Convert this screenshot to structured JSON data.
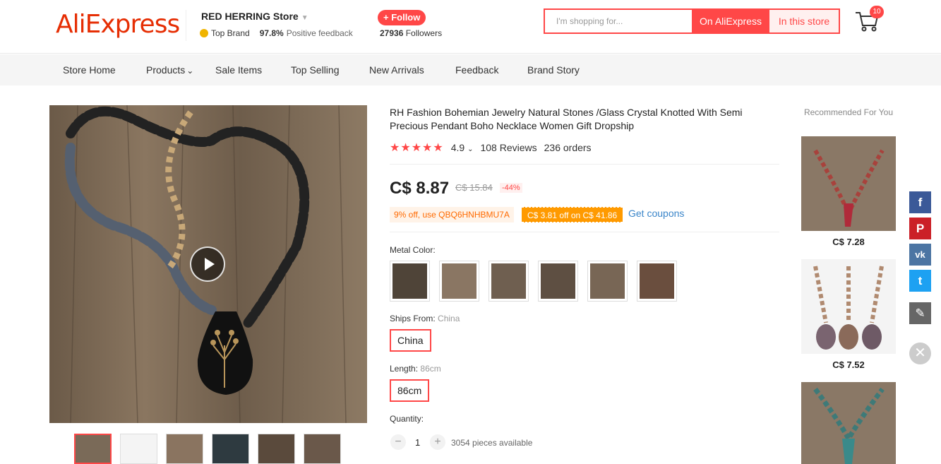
{
  "header": {
    "logo_text": "AliExpress",
    "store_name": "RED HERRING Store",
    "top_brand": "Top Brand",
    "positive_pct": "97.8%",
    "positive_label": "Positive feedback",
    "follow_label": "+ Follow",
    "followers_count": "27936",
    "followers_label": "Followers",
    "search_placeholder": "I'm shopping for...",
    "search_ali_label": "On AliExpress",
    "search_store_label": "In this store",
    "cart_count": "10"
  },
  "nav": {
    "items": [
      "Store Home",
      "Products",
      "Sale Items",
      "Top Selling",
      "New Arrivals",
      "Feedback",
      "Brand Story"
    ]
  },
  "product": {
    "title": "RH Fashion Bohemian Jewelry Natural Stones /Glass Crystal Knotted With Semi Precious Pendant Boho Necklace Women Gift Dropship",
    "rating": "4.9",
    "reviews": "108 Reviews",
    "orders": "236 orders",
    "price": "C$ 8.87",
    "price_old": "C$ 15.84",
    "discount": "-44%",
    "coupon_code_text": "9% off, use QBQ6HNHBMU7A",
    "coupon_store_text": "C$ 3.81 off on C$ 41.86",
    "get_coupons": "Get coupons",
    "metal_color_label": "Metal Color:",
    "ships_from_label": "Ships From:",
    "ships_from_value": "China",
    "ships_from_option": "China",
    "length_label": "Length:",
    "length_value": "86cm",
    "length_option": "86cm",
    "quantity_label": "Quantity:",
    "quantity_value": "1",
    "quantity_available": "3054 pieces available"
  },
  "recommended": {
    "title": "Recommended For You",
    "items": [
      {
        "price": "C$ 7.28"
      },
      {
        "price": "C$ 7.52"
      }
    ]
  },
  "share": {
    "facebook": "f",
    "pinterest": "P",
    "vk": "vk",
    "twitter": "t",
    "edit": "✎",
    "close": "✕"
  },
  "colors": {
    "brand": "#ff4747",
    "logo": "#e62e04",
    "coupon_orange": "#ff9a00",
    "link_blue": "#3a85c9",
    "facebook": "#3b5998",
    "pinterest": "#cb2027",
    "vk": "#4c75a3",
    "twitter": "#1da1f2",
    "edit": "#666666"
  }
}
